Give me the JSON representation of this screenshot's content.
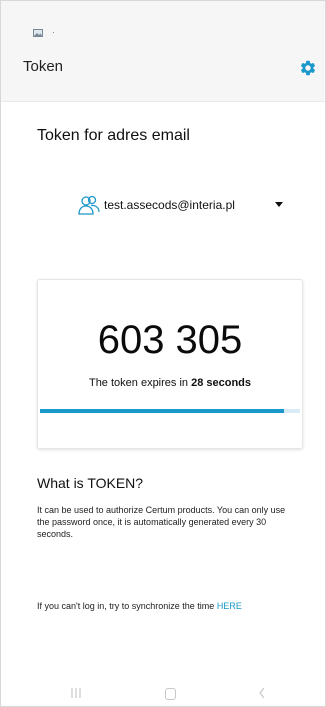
{
  "app": {
    "title": "Token",
    "status_dot": "·"
  },
  "account": {
    "heading": "Token for adres email",
    "email": "test.assecods@interia.pl"
  },
  "token": {
    "code": "603 305",
    "expiry_prefix": "The token expires in ",
    "expiry_value": "28 seconds",
    "progress_fraction": 0.94
  },
  "info": {
    "title": "What is TOKEN?",
    "description": "It can be used to authorize Certum products. You can only use the password once, it is automatically generated every 30 seconds."
  },
  "sync": {
    "text": "If you can't log in, try to synchronize the time ",
    "link": "HERE"
  },
  "colors": {
    "accent": "#1a98c9",
    "progress_track": "#d9ecf6"
  },
  "icons": {
    "settings": "gear-icon",
    "account": "users-icon",
    "dropdown": "caret-down-icon",
    "status": "image-notification-icon"
  }
}
